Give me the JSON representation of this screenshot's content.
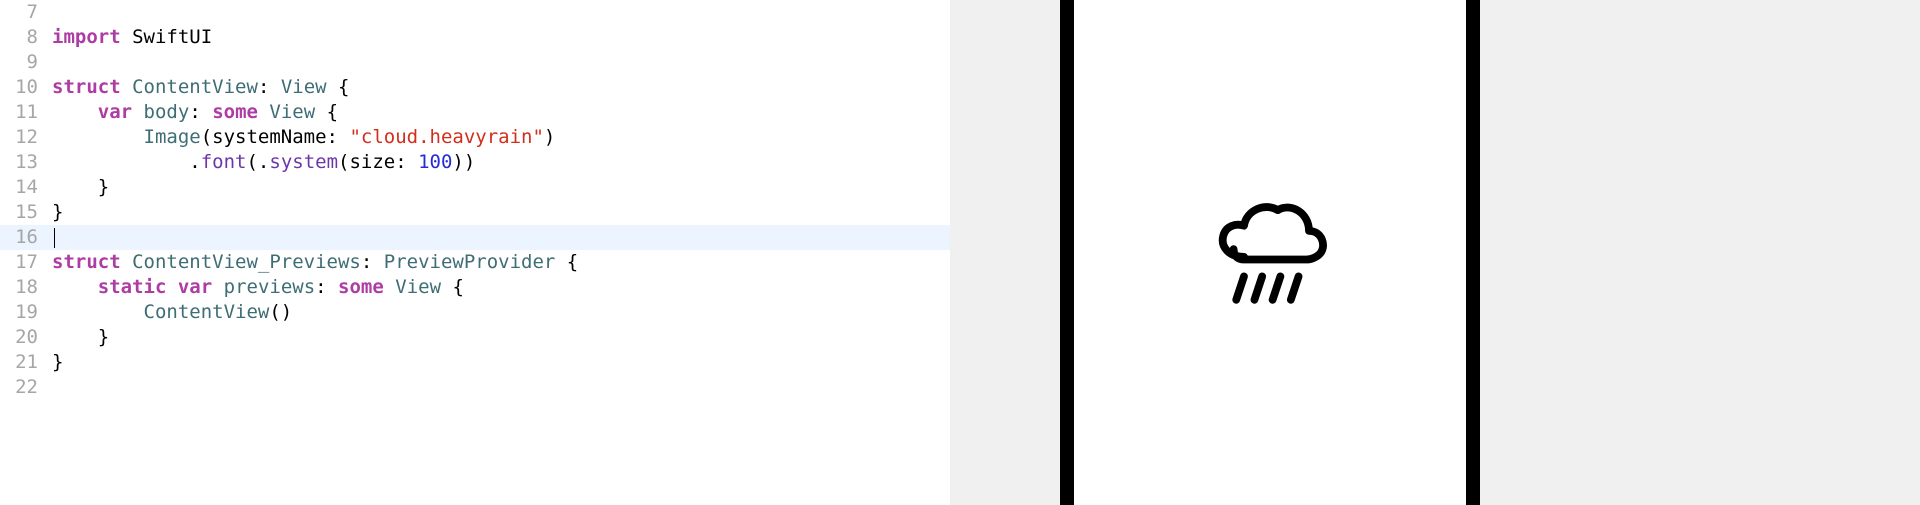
{
  "editor": {
    "lines": [
      {
        "num": 7,
        "tokens": []
      },
      {
        "num": 8,
        "tokens": [
          {
            "cls": "tok-keyword",
            "text": "import"
          },
          {
            "cls": "tok-plain",
            "text": " SwiftUI"
          }
        ]
      },
      {
        "num": 9,
        "tokens": []
      },
      {
        "num": 10,
        "tokens": [
          {
            "cls": "tok-keyword",
            "text": "struct"
          },
          {
            "cls": "tok-plain",
            "text": " "
          },
          {
            "cls": "tok-type",
            "text": "ContentView"
          },
          {
            "cls": "tok-plain",
            "text": ": "
          },
          {
            "cls": "tok-type",
            "text": "View"
          },
          {
            "cls": "tok-plain",
            "text": " {"
          }
        ]
      },
      {
        "num": 11,
        "tokens": [
          {
            "cls": "tok-plain",
            "text": "    "
          },
          {
            "cls": "tok-keyword",
            "text": "var"
          },
          {
            "cls": "tok-plain",
            "text": " "
          },
          {
            "cls": "tok-property",
            "text": "body"
          },
          {
            "cls": "tok-plain",
            "text": ": "
          },
          {
            "cls": "tok-keyword",
            "text": "some"
          },
          {
            "cls": "tok-plain",
            "text": " "
          },
          {
            "cls": "tok-type",
            "text": "View"
          },
          {
            "cls": "tok-plain",
            "text": " {"
          }
        ]
      },
      {
        "num": 12,
        "tokens": [
          {
            "cls": "tok-plain",
            "text": "        "
          },
          {
            "cls": "tok-type",
            "text": "Image"
          },
          {
            "cls": "tok-plain",
            "text": "(systemName: "
          },
          {
            "cls": "tok-string",
            "text": "\"cloud.heavyrain\""
          },
          {
            "cls": "tok-plain",
            "text": ")"
          }
        ]
      },
      {
        "num": 13,
        "tokens": [
          {
            "cls": "tok-plain",
            "text": "            ."
          },
          {
            "cls": "tok-method",
            "text": "font"
          },
          {
            "cls": "tok-plain",
            "text": "(."
          },
          {
            "cls": "tok-method",
            "text": "system"
          },
          {
            "cls": "tok-plain",
            "text": "(size: "
          },
          {
            "cls": "tok-number",
            "text": "100"
          },
          {
            "cls": "tok-plain",
            "text": "))"
          }
        ]
      },
      {
        "num": 14,
        "tokens": [
          {
            "cls": "tok-plain",
            "text": "    }"
          }
        ]
      },
      {
        "num": 15,
        "tokens": [
          {
            "cls": "tok-plain",
            "text": "}"
          }
        ]
      },
      {
        "num": 16,
        "highlighted": true,
        "cursor": true,
        "tokens": []
      },
      {
        "num": 17,
        "tokens": [
          {
            "cls": "tok-keyword",
            "text": "struct"
          },
          {
            "cls": "tok-plain",
            "text": " "
          },
          {
            "cls": "tok-type",
            "text": "ContentView_Previews"
          },
          {
            "cls": "tok-plain",
            "text": ": "
          },
          {
            "cls": "tok-type",
            "text": "PreviewProvider"
          },
          {
            "cls": "tok-plain",
            "text": " {"
          }
        ]
      },
      {
        "num": 18,
        "tokens": [
          {
            "cls": "tok-plain",
            "text": "    "
          },
          {
            "cls": "tok-keyword",
            "text": "static"
          },
          {
            "cls": "tok-plain",
            "text": " "
          },
          {
            "cls": "tok-keyword",
            "text": "var"
          },
          {
            "cls": "tok-plain",
            "text": " "
          },
          {
            "cls": "tok-property",
            "text": "previews"
          },
          {
            "cls": "tok-plain",
            "text": ": "
          },
          {
            "cls": "tok-keyword",
            "text": "some"
          },
          {
            "cls": "tok-plain",
            "text": " "
          },
          {
            "cls": "tok-type",
            "text": "View"
          },
          {
            "cls": "tok-plain",
            "text": " {"
          }
        ]
      },
      {
        "num": 19,
        "tokens": [
          {
            "cls": "tok-plain",
            "text": "        "
          },
          {
            "cls": "tok-type",
            "text": "ContentView"
          },
          {
            "cls": "tok-plain",
            "text": "()"
          }
        ]
      },
      {
        "num": 20,
        "tokens": [
          {
            "cls": "tok-plain",
            "text": "    }"
          }
        ]
      },
      {
        "num": 21,
        "tokens": [
          {
            "cls": "tok-plain",
            "text": "}"
          }
        ]
      },
      {
        "num": 22,
        "tokens": []
      }
    ]
  },
  "preview": {
    "icon_name": "cloud-heavyrain-icon"
  }
}
